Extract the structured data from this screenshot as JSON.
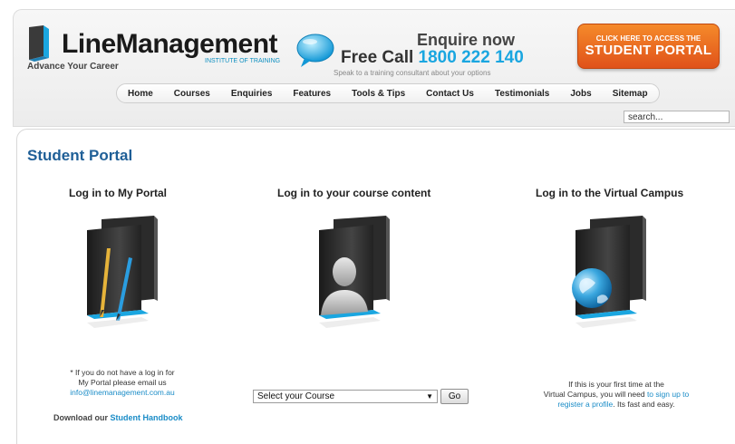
{
  "header": {
    "logo": {
      "name": "LineManagement",
      "subtitle": "INSTITUTE OF TRAINING",
      "tagline": "Advance Your Career"
    },
    "enquire": {
      "heading": "Enquire now",
      "free_call": "Free Call",
      "phone": "1800 222 140",
      "subtext": "Speak to a training consultant about your options"
    },
    "portal_button": {
      "small": "CLICK HERE TO ACCESS THE",
      "big": "STUDENT PORTAL"
    },
    "colors": {
      "accent_blue": "#1aa6e0",
      "portal_orange": "#e8621e",
      "title_blue": "#1f5f97"
    }
  },
  "nav": {
    "items": [
      {
        "label": "Home"
      },
      {
        "label": "Courses"
      },
      {
        "label": "Enquiries"
      },
      {
        "label": "Features"
      },
      {
        "label": "Tools & Tips"
      },
      {
        "label": "Contact Us"
      },
      {
        "label": "Testimonials"
      },
      {
        "label": "Jobs"
      },
      {
        "label": "Sitemap"
      }
    ]
  },
  "search": {
    "value": "search..."
  },
  "main": {
    "title": "Student Portal",
    "columns": [
      {
        "heading": "Log in to My Portal",
        "icon": "folder-pencils-icon",
        "note_line1": "* If you do not have a log in for",
        "note_line2": "My Portal please email us",
        "email": "info@linemanagement.com.au",
        "handbook_prefix": "Download our",
        "handbook_link": "Student Handbook"
      },
      {
        "heading": "Log in to your course content",
        "icon": "folder-user-icon",
        "select_value": "Select your Course",
        "go_label": "Go"
      },
      {
        "heading": "Log in to the Virtual Campus",
        "icon": "folder-globe-icon",
        "note_line1": "If this is your first time at the",
        "note_line2_prefix": "Virtual Campus, you will need",
        "signup_link_1": "to sign up to",
        "signup_link_2": "register a profile",
        "note_suffix": ". Its fast and easy."
      }
    ]
  }
}
